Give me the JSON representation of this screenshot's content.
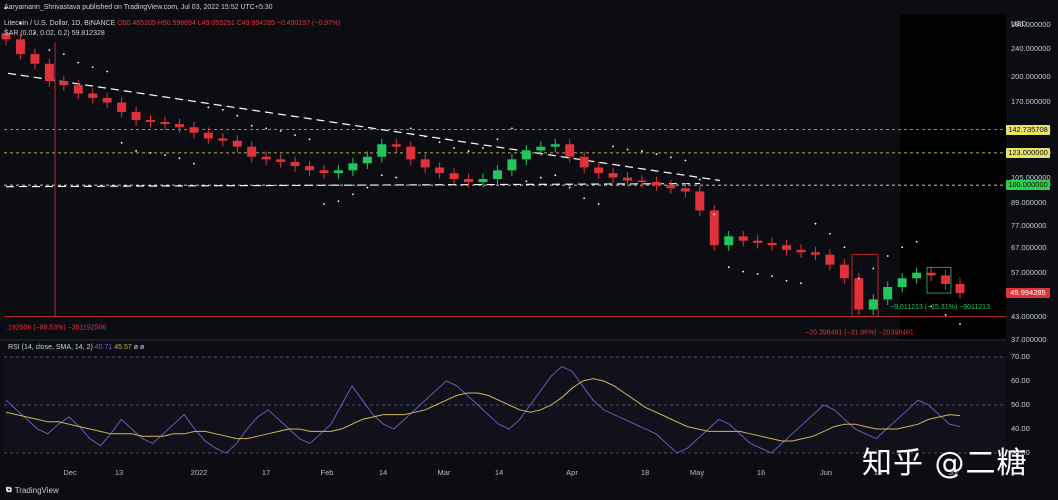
{
  "header": {
    "published": "Aaryamann_Shrivastava published on TradingView.com, Jul 03, 2022 15:52 UTC+5:30",
    "symbol": "Litecoin / U.S. Dollar, 1D, BINANCE",
    "ohlc": "O50.465205 H50.598694 L49.059291 C49.994285 −0.490197 (−0.97%)",
    "sar": "SAR (0.02, 0.02, 0.2) 59.812328",
    "rsi_label": "RSI (14, close, SMA, 14, 2)",
    "rsi_values": [
      "40.71",
      "45.57",
      "ø",
      "ø"
    ]
  },
  "price_axis": {
    "currency": "USD",
    "ticks": [
      "280.000000",
      "240.000000",
      "200.000000",
      "170.000000",
      "142.735708",
      "123.000000",
      "105.000000",
      "100.000000",
      "89.000000",
      "77.000000",
      "67.000000",
      "57.000000",
      "49.994285",
      "43.000000",
      "37.000000"
    ],
    "badges": [
      {
        "label": "142.735708",
        "bg": "#e6e36a",
        "fg": "#111111"
      },
      {
        "label": "123.000000",
        "bg": "#e6e36a",
        "fg": "#111111"
      },
      {
        "label": "100.000000",
        "bg": "#2fd14b",
        "fg": "#0b0d12"
      },
      {
        "label": "49.994285",
        "bg": "#e0323a",
        "fg": "#ffffff"
      }
    ]
  },
  "rsi_axis": {
    "ticks": [
      "70.00",
      "60.00",
      "50.00",
      "40.00",
      "30.00"
    ]
  },
  "x_axis": {
    "ticks": [
      "Dec",
      "13",
      "2022",
      "17",
      "Feb",
      "14",
      "Mar",
      "14",
      "Apr",
      "18",
      "May",
      "16",
      "Jun",
      "13",
      "Jul"
    ]
  },
  "annotations": {
    "left_measure": ".192506 (−88.53%) −351192506",
    "drop_measure": "−20.398481 (−31.96%) −20398481",
    "range_measure": "−9.011213 (−15.31%) −9011213"
  },
  "footer": {
    "brand": "TradingView"
  },
  "watermark": "知乎 @二糖",
  "colors": {
    "up": "#22c55e",
    "down": "#e0323a",
    "yellow": "#e6e36a",
    "green_line": "#2fd14b",
    "rsi": "#7c5cc4",
    "rsi_ma": "#d4b25a"
  },
  "chart_data": {
    "type": "candlestick",
    "symbol": "LTC/USD",
    "interval": "1D",
    "x_range": [
      "2021-11-20",
      "2022-07-03"
    ],
    "y_scale": "log",
    "ylim": [
      37,
      300
    ],
    "horizontal_levels": [
      142.735708,
      123,
      100,
      43
    ],
    "last_close": 49.994285,
    "close_path": [
      255,
      232,
      218,
      195,
      190,
      180,
      175,
      170,
      160,
      152,
      150,
      148,
      145,
      140,
      135,
      133,
      128,
      120,
      118,
      116,
      113,
      110,
      108,
      110,
      115,
      120,
      130,
      128,
      118,
      112,
      108,
      104,
      102,
      104,
      110,
      118,
      125,
      128,
      130,
      120,
      112,
      108,
      105,
      103,
      102,
      100,
      98,
      96,
      85,
      68,
      72,
      70,
      69,
      68,
      66,
      65,
      64,
      60,
      55,
      45,
      48,
      52,
      55,
      57,
      56,
      53,
      50
    ],
    "sar": {
      "params": "0.02, 0.02, 0.2",
      "value": 59.812328
    },
    "rsi": {
      "params": "14, close, SMA, 14, 2",
      "value": 40.71,
      "ma": 45.57,
      "levels": [
        70,
        50,
        30
      ],
      "ylim": [
        25,
        75
      ],
      "series": [
        52,
        48,
        44,
        40,
        38,
        42,
        45,
        41,
        36,
        33,
        38,
        44,
        40,
        36,
        34,
        38,
        42,
        46,
        40,
        35,
        32,
        30,
        34,
        40,
        45,
        48,
        44,
        40,
        36,
        34,
        38,
        42,
        50,
        58,
        52,
        46,
        42,
        40,
        44,
        48,
        52,
        56,
        60,
        58,
        54,
        50,
        46,
        42,
        40,
        44,
        50,
        56,
        62,
        66,
        64,
        58,
        52,
        48,
        46,
        44,
        42,
        40,
        38,
        34,
        30,
        32,
        36,
        40,
        44,
        42,
        38,
        34,
        32,
        30,
        34,
        38,
        42,
        46,
        50,
        48,
        44,
        40,
        38,
        36,
        40,
        44,
        48,
        52,
        50,
        46,
        42,
        41
      ],
      "ma_series": [
        47,
        46,
        45,
        44,
        43,
        43,
        42,
        41,
        40,
        39,
        38,
        38,
        38,
        37,
        37,
        37,
        38,
        38,
        39,
        39,
        38,
        37,
        36,
        36,
        37,
        38,
        39,
        40,
        40,
        39,
        39,
        39,
        40,
        42,
        44,
        45,
        46,
        46,
        46,
        47,
        48,
        50,
        52,
        54,
        55,
        55,
        54,
        52,
        50,
        48,
        47,
        48,
        50,
        53,
        57,
        60,
        61,
        60,
        58,
        55,
        52,
        49,
        47,
        45,
        43,
        41,
        40,
        39,
        39,
        39,
        39,
        38,
        37,
        36,
        35,
        35,
        36,
        37,
        39,
        41,
        42,
        42,
        41,
        40,
        40,
        40,
        41,
        42,
        44,
        45,
        46,
        45.57
      ]
    }
  }
}
